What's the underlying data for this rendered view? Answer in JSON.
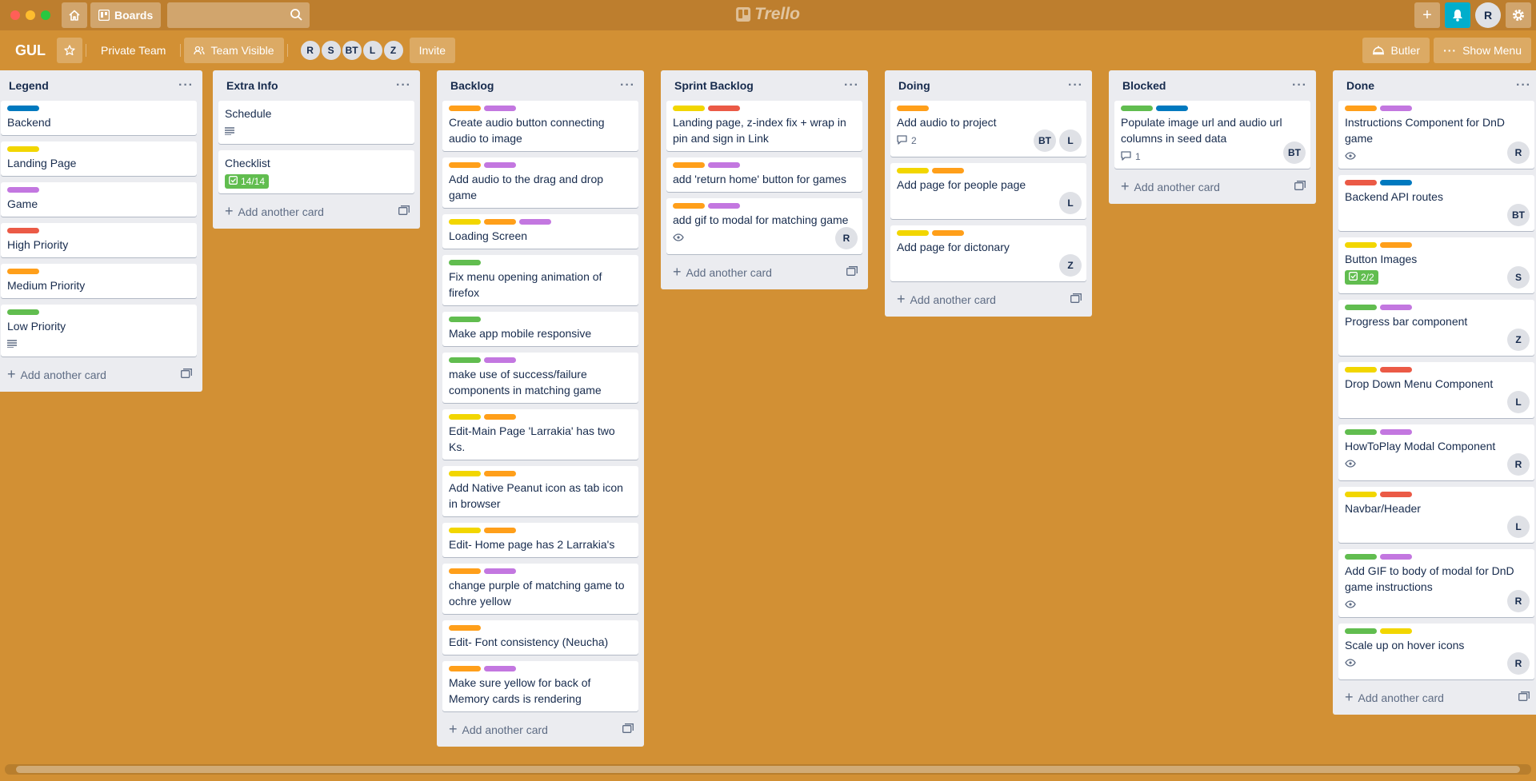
{
  "colors": {
    "background": "#d29034",
    "green": "#61bd4f",
    "yellow": "#f2d600",
    "orange": "#ff9f1a",
    "red": "#eb5a46",
    "purple": "#c377e0",
    "blue": "#0079bf"
  },
  "topbar": {
    "home_icon": "home-icon",
    "boards_label": "Boards",
    "search_placeholder": "",
    "logo_text": "Trello",
    "user_initial": "R"
  },
  "board": {
    "title": "GUL",
    "team_label": "Private Team",
    "visibility_label": "Team Visible",
    "members": [
      "R",
      "S",
      "BT",
      "L",
      "Z"
    ],
    "invite_label": "Invite",
    "butler_label": "Butler",
    "menu_label": "Show Menu"
  },
  "add_card_label": "Add another card",
  "lists": [
    {
      "title": "Legend",
      "cards": [
        {
          "labels": [
            "blue"
          ],
          "title": "Backend"
        },
        {
          "labels": [
            "yellow"
          ],
          "title": "Landing Page"
        },
        {
          "labels": [
            "purple"
          ],
          "title": "Game"
        },
        {
          "labels": [
            "red"
          ],
          "title": "High Priority"
        },
        {
          "labels": [
            "orange"
          ],
          "title": "Medium Priority"
        },
        {
          "labels": [
            "green"
          ],
          "title": "Low Priority",
          "description": true
        }
      ]
    },
    {
      "title": "Extra Info",
      "cards": [
        {
          "labels": [],
          "title": "Schedule",
          "description": true
        },
        {
          "labels": [],
          "title": "Checklist",
          "checklist": "14/14"
        }
      ]
    },
    {
      "title": "Backlog",
      "cards": [
        {
          "labels": [
            "orange",
            "purple"
          ],
          "title": "Create audio button connecting audio to image"
        },
        {
          "labels": [
            "orange",
            "purple"
          ],
          "title": "Add audio to the drag and drop game"
        },
        {
          "labels": [
            "yellow",
            "orange",
            "purple"
          ],
          "title": "Loading Screen"
        },
        {
          "labels": [
            "green"
          ],
          "title": "Fix menu opening animation of firefox"
        },
        {
          "labels": [
            "green"
          ],
          "title": "Make app mobile responsive"
        },
        {
          "labels": [
            "green",
            "purple"
          ],
          "title": "make use of success/failure components in matching game"
        },
        {
          "labels": [
            "yellow",
            "orange"
          ],
          "title": "Edit-Main Page 'Larrakia' has two Ks."
        },
        {
          "labels": [
            "yellow",
            "orange"
          ],
          "title": "Add Native Peanut icon as tab icon in browser"
        },
        {
          "labels": [
            "yellow",
            "orange"
          ],
          "title": "Edit- Home page has 2 Larrakia's"
        },
        {
          "labels": [
            "orange",
            "purple"
          ],
          "title": "change purple of matching game to ochre yellow"
        },
        {
          "labels": [
            "orange"
          ],
          "title": "Edit- Font consistency (Neucha)"
        },
        {
          "labels": [
            "orange",
            "purple"
          ],
          "title": "Make sure yellow for back of Memory cards is rendering"
        }
      ]
    },
    {
      "title": "Sprint Backlog",
      "cards": [
        {
          "labels": [
            "yellow",
            "red"
          ],
          "title": "Landing page, z-index fix + wrap in pin and sign in Link"
        },
        {
          "labels": [
            "orange",
            "purple"
          ],
          "title": "add 'return home' button for games"
        },
        {
          "labels": [
            "orange",
            "purple"
          ],
          "title": "add gif to modal for matching game",
          "watch": true,
          "members": [
            "R"
          ]
        }
      ]
    },
    {
      "title": "Doing",
      "cards": [
        {
          "labels": [
            "orange"
          ],
          "title": "Add audio to project",
          "comments": "2",
          "members": [
            "BT",
            "L"
          ]
        },
        {
          "labels": [
            "yellow",
            "orange"
          ],
          "title": "Add page for people page",
          "members": [
            "L"
          ]
        },
        {
          "labels": [
            "yellow",
            "orange"
          ],
          "title": "Add page for dictonary",
          "members": [
            "Z"
          ]
        }
      ]
    },
    {
      "title": "Blocked",
      "cards": [
        {
          "labels": [
            "green",
            "blue"
          ],
          "title": "Populate image url and audio url columns in seed data",
          "comments": "1",
          "members": [
            "BT"
          ]
        }
      ]
    },
    {
      "title": "Done",
      "cards": [
        {
          "labels": [
            "orange",
            "purple"
          ],
          "title": "Instructions Component for DnD game",
          "watch": true,
          "members": [
            "R"
          ]
        },
        {
          "labels": [
            "red",
            "blue"
          ],
          "title": "Backend API routes",
          "members": [
            "BT"
          ]
        },
        {
          "labels": [
            "yellow",
            "orange"
          ],
          "title": "Button Images",
          "checklist": "2/2",
          "members": [
            "S"
          ]
        },
        {
          "labels": [
            "green",
            "purple"
          ],
          "title": "Progress bar component",
          "members": [
            "Z"
          ]
        },
        {
          "labels": [
            "yellow",
            "red"
          ],
          "title": "Drop Down Menu Component",
          "members": [
            "L"
          ]
        },
        {
          "labels": [
            "green",
            "purple"
          ],
          "title": "HowToPlay Modal Component",
          "watch": true,
          "members": [
            "R"
          ]
        },
        {
          "labels": [
            "yellow",
            "red"
          ],
          "title": "Navbar/Header",
          "members": [
            "L"
          ]
        },
        {
          "labels": [
            "green",
            "purple"
          ],
          "title": "Add GIF to body of modal for DnD game instructions",
          "watch": true,
          "members": [
            "R"
          ]
        },
        {
          "labels": [
            "green",
            "yellow"
          ],
          "title": "Scale up on hover icons",
          "watch": true,
          "members": [
            "R"
          ]
        }
      ]
    }
  ]
}
